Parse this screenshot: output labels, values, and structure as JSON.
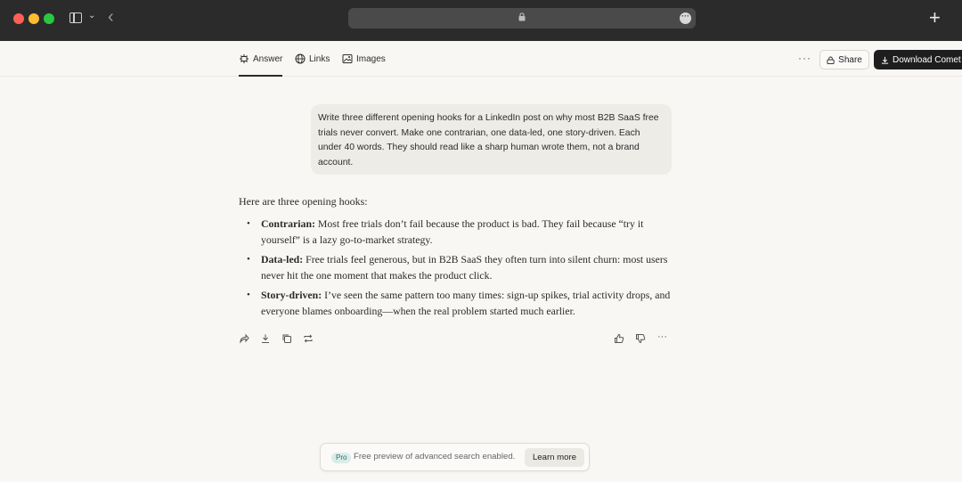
{
  "browser": {
    "window_controls": [
      "close",
      "minimize",
      "zoom"
    ],
    "icons": [
      "sidebar-icon",
      "chevron-down-icon",
      "back-arrow-icon",
      "lock-icon",
      "more-icon",
      "plus-icon"
    ]
  },
  "toolbar": {
    "tabs": [
      {
        "label": "Answer",
        "icon": "answer-icon",
        "active": true
      },
      {
        "label": "Links",
        "icon": "globe-icon"
      },
      {
        "label": "Images",
        "icon": "image-icon"
      }
    ],
    "more": "···",
    "share_label": "Share",
    "download_label": "Download Comet"
  },
  "query": {
    "text": "Write three different opening hooks for a LinkedIn post on why most B2B SaaS free trials never convert. Make one contrarian, one data-led, one story-driven. Each under 40 words. They should read like a sharp human wrote them, not a brand account."
  },
  "answer": {
    "intro": "Here are three opening hooks:",
    "hooks": [
      {
        "label": "Contrarian:",
        "text": " Most free trials don’t fail because the product is bad. They fail because “try it yourself” is a lazy go-to-market strategy."
      },
      {
        "label": "Data-led:",
        "text": " Free trials feel generous, but in B2B SaaS they often turn into silent churn: most users never hit the one moment that makes the product click."
      },
      {
        "label": "Story-driven:",
        "text": " I’ve seen the same pattern too many times: sign-up spikes, trial activity drops, and everyone blames onboarding—when the real problem started much earlier."
      }
    ]
  },
  "actions": {
    "left": [
      "share-icon",
      "download-icon",
      "copy-icon",
      "rewrite-icon"
    ],
    "right": [
      "thumbs-up-icon",
      "thumbs-down-icon",
      "more-icon"
    ],
    "more": "···"
  },
  "banner": {
    "badge": "Pro",
    "text": "Free preview of advanced search enabled.",
    "button": "Learn more"
  },
  "colors": {
    "page_bg": "#f8f7f4",
    "titlebar": "#2b2b2b",
    "query_bubble": "#eeece7",
    "download_button": "#1e1e1e",
    "pro_badge": "#d9ece8"
  }
}
